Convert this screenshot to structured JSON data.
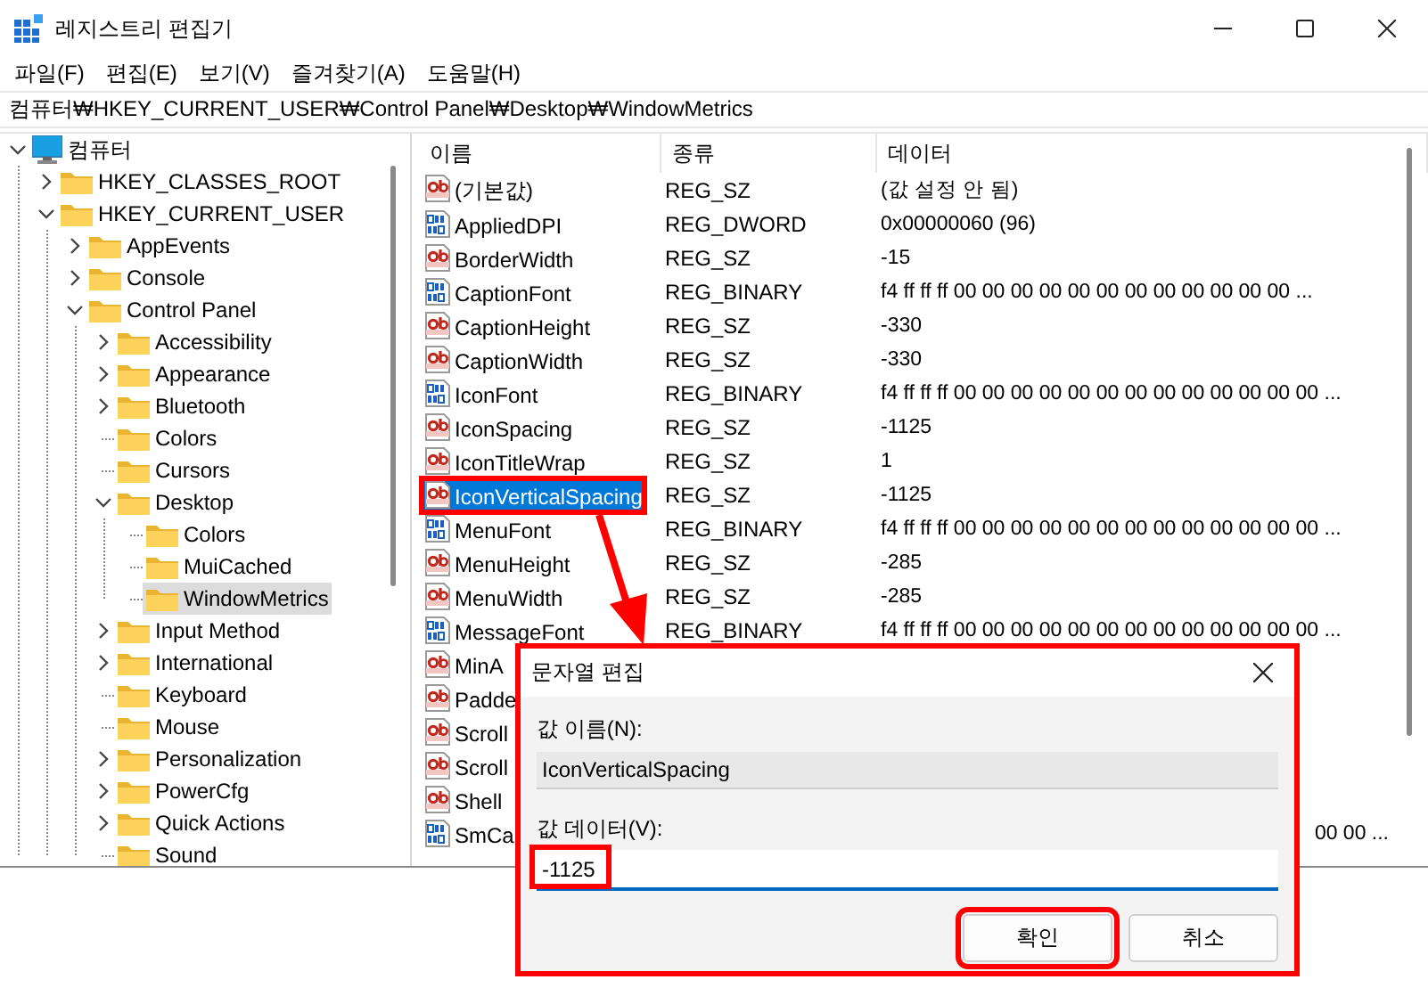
{
  "window": {
    "title": "레지스트리 편집기"
  },
  "menu": [
    "파일(F)",
    "편집(E)",
    "보기(V)",
    "즐겨찾기(A)",
    "도움말(H)"
  ],
  "address": "컴퓨터₩HKEY_CURRENT_USER₩Control Panel₩Desktop₩WindowMetrics",
  "tree": [
    {
      "label": "컴퓨터",
      "kind": "computer",
      "expanded": true,
      "selected": false,
      "children": [
        {
          "label": "HKEY_CLASSES_ROOT",
          "kind": "branch",
          "expanded": false,
          "selected": false
        },
        {
          "label": "HKEY_CURRENT_USER",
          "kind": "branch",
          "expanded": true,
          "selected": false,
          "children": [
            {
              "label": "AppEvents",
              "kind": "branch",
              "expanded": false,
              "selected": false
            },
            {
              "label": "Console",
              "kind": "branch",
              "expanded": false,
              "selected": false
            },
            {
              "label": "Control Panel",
              "kind": "branch",
              "expanded": true,
              "selected": false,
              "children": [
                {
                  "label": "Accessibility",
                  "kind": "branch",
                  "expanded": false,
                  "selected": false
                },
                {
                  "label": "Appearance",
                  "kind": "branch",
                  "expanded": false,
                  "selected": false
                },
                {
                  "label": "Bluetooth",
                  "kind": "branch",
                  "expanded": false,
                  "selected": false
                },
                {
                  "label": "Colors",
                  "kind": "leaf",
                  "selected": false
                },
                {
                  "label": "Cursors",
                  "kind": "leaf",
                  "selected": false
                },
                {
                  "label": "Desktop",
                  "kind": "branch",
                  "expanded": true,
                  "selected": false,
                  "children": [
                    {
                      "label": "Colors",
                      "kind": "leaf",
                      "selected": false
                    },
                    {
                      "label": "MuiCached",
                      "kind": "leaf",
                      "selected": false
                    },
                    {
                      "label": "WindowMetrics",
                      "kind": "leaf",
                      "selected": true
                    }
                  ]
                },
                {
                  "label": "Input Method",
                  "kind": "branch",
                  "expanded": false,
                  "selected": false
                },
                {
                  "label": "International",
                  "kind": "branch",
                  "expanded": false,
                  "selected": false
                },
                {
                  "label": "Keyboard",
                  "kind": "leaf",
                  "selected": false
                },
                {
                  "label": "Mouse",
                  "kind": "leaf",
                  "selected": false
                },
                {
                  "label": "Personalization",
                  "kind": "branch",
                  "expanded": false,
                  "selected": false
                },
                {
                  "label": "PowerCfg",
                  "kind": "branch",
                  "expanded": false,
                  "selected": false
                },
                {
                  "label": "Quick Actions",
                  "kind": "branch",
                  "expanded": false,
                  "selected": false
                },
                {
                  "label": "Sound",
                  "kind": "leaf",
                  "selected": false
                }
              ]
            }
          ]
        }
      ]
    }
  ],
  "list": {
    "columns": [
      "이름",
      "종류",
      "데이터"
    ],
    "rows": [
      {
        "kind": "string",
        "name": "(기본값)",
        "type": "REG_SZ",
        "data": "(값 설정 안 됨)",
        "selected": false,
        "highlighted": false
      },
      {
        "kind": "binary",
        "name": "AppliedDPI",
        "type": "REG_DWORD",
        "data": "0x00000060 (96)",
        "selected": false,
        "highlighted": false
      },
      {
        "kind": "string",
        "name": "BorderWidth",
        "type": "REG_SZ",
        "data": "-15",
        "selected": false,
        "highlighted": false
      },
      {
        "kind": "binary",
        "name": "CaptionFont",
        "type": "REG_BINARY",
        "data": "f4 ff ff ff 00 00 00 00 00 00 00 00 00 00 00 00 ...",
        "selected": false,
        "highlighted": false
      },
      {
        "kind": "string",
        "name": "CaptionHeight",
        "type": "REG_SZ",
        "data": "-330",
        "selected": false,
        "highlighted": false
      },
      {
        "kind": "string",
        "name": "CaptionWidth",
        "type": "REG_SZ",
        "data": "-330",
        "selected": false,
        "highlighted": false
      },
      {
        "kind": "binary",
        "name": "IconFont",
        "type": "REG_BINARY",
        "data": "f4 ff ff ff 00 00 00 00 00 00 00 00 00 00 00 00 00 ...",
        "selected": false,
        "highlighted": false
      },
      {
        "kind": "string",
        "name": "IconSpacing",
        "type": "REG_SZ",
        "data": "-1125",
        "selected": false,
        "highlighted": false
      },
      {
        "kind": "string",
        "name": "IconTitleWrap",
        "type": "REG_SZ",
        "data": "1",
        "selected": false,
        "highlighted": false
      },
      {
        "kind": "string",
        "name": "IconVerticalSpacing",
        "type": "REG_SZ",
        "data": "-1125",
        "selected": true,
        "highlighted": true
      },
      {
        "kind": "binary",
        "name": "MenuFont",
        "type": "REG_BINARY",
        "data": "f4 ff ff ff 00 00 00 00 00 00 00 00 00 00 00 00 00 ...",
        "selected": false,
        "highlighted": false
      },
      {
        "kind": "string",
        "name": "MenuHeight",
        "type": "REG_SZ",
        "data": "-285",
        "selected": false,
        "highlighted": false
      },
      {
        "kind": "string",
        "name": "MenuWidth",
        "type": "REG_SZ",
        "data": "-285",
        "selected": false,
        "highlighted": false
      },
      {
        "kind": "binary",
        "name": "MessageFont",
        "type": "REG_BINARY",
        "data": "f4 ff ff ff 00 00 00 00 00 00 00 00 00 00 00 00 00 ...",
        "selected": false,
        "highlighted": false
      },
      {
        "kind": "string",
        "name": "MinA",
        "selected": false,
        "highlighted": false
      },
      {
        "kind": "string",
        "name": "Padde",
        "selected": false,
        "highlighted": false
      },
      {
        "kind": "string",
        "name": "Scroll",
        "selected": false,
        "highlighted": false
      },
      {
        "kind": "string",
        "name": "Scroll",
        "selected": false,
        "highlighted": false
      },
      {
        "kind": "string",
        "name": "Shell",
        "selected": false,
        "highlighted": false
      },
      {
        "kind": "binary",
        "name": "SmCa",
        "data": "00 00 ...",
        "selected": false,
        "highlighted": false
      }
    ]
  },
  "annotation_arrow": true,
  "dialog": {
    "title": "문자열 편집",
    "highlighted": true,
    "name_label": "값 이름(N):",
    "name_value": "IconVerticalSpacing",
    "data_label": "값 데이터(V):",
    "data_value": "-1125",
    "data_value_highlighted": true,
    "buttons": [
      {
        "label": "확인",
        "highlighted": true
      },
      {
        "label": "취소",
        "highlighted": false
      }
    ]
  }
}
